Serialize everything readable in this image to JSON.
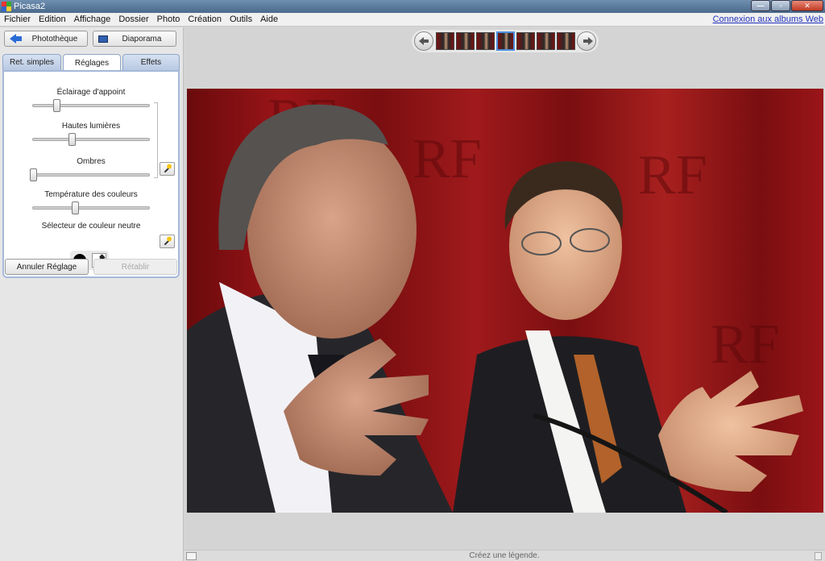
{
  "window": {
    "title": "Picasa2"
  },
  "menu": {
    "items": [
      "Fichier",
      "Edition",
      "Affichage",
      "Dossier",
      "Photo",
      "Création",
      "Outils",
      "Aide"
    ],
    "web_link": "Connexion aux albums Web"
  },
  "sidebar": {
    "library_label": "Photothèque",
    "slideshow_label": "Diaporama",
    "tabs": [
      "Ret. simples",
      "Réglages",
      "Effets"
    ],
    "active_tab": "Réglages",
    "sliders": [
      {
        "label": "Éclairage d'appoint",
        "value": 0.2
      },
      {
        "label": "Hautes lumières",
        "value": 0.33
      },
      {
        "label": "Ombres",
        "value": 0.0
      },
      {
        "label": "Température des couleurs",
        "value": 0.36
      }
    ],
    "neutral_picker_label": "Sélecteur de couleur neutre",
    "neutral_color": "#000000",
    "undo_label": "Annuler Réglage",
    "redo_label": "Rétablir"
  },
  "filmstrip": {
    "count": 7,
    "active_index": 3
  },
  "caption": {
    "placeholder": "Créez une légende."
  },
  "colors": {
    "accent": "#2a6bd6",
    "tab_border": "#8ea6c8",
    "curtain": "#8a0f12"
  }
}
